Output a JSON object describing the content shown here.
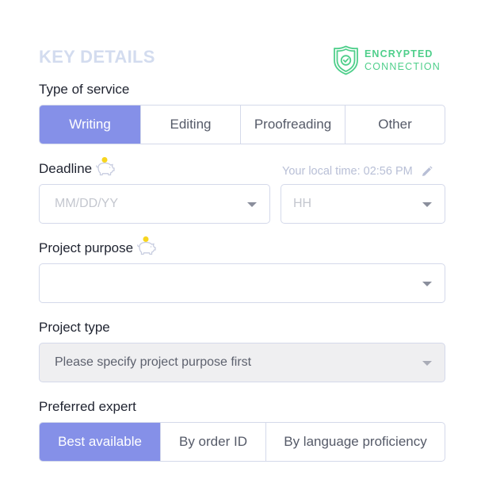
{
  "header": {
    "title": "KEY DETAILS",
    "secure_badge": {
      "icon": "shield-check-icon",
      "line1": "ENCRYPTED",
      "line2": "CONNECTION",
      "color": "#4fcf8b"
    }
  },
  "service": {
    "label": "Type of service",
    "options": [
      "Writing",
      "Editing",
      "Proofreading",
      "Other"
    ],
    "selected": "Writing"
  },
  "deadline": {
    "label": "Deadline",
    "icon": "piggy-bank-icon",
    "local_time_label": "Your local time: 02:56 PM",
    "edit_icon": "pencil-icon",
    "date_placeholder": "MM/DD/YY",
    "hour_placeholder": "HH"
  },
  "project_purpose": {
    "label": "Project purpose",
    "icon": "piggy-bank-icon",
    "value": ""
  },
  "project_type": {
    "label": "Project type",
    "placeholder": "Please specify project purpose first",
    "disabled": true
  },
  "preferred_expert": {
    "label": "Preferred expert",
    "options": [
      "Best available",
      "By order ID",
      "By language proficiency"
    ],
    "selected": "Best available"
  },
  "colors": {
    "accent": "#8590e8",
    "title": "#d3dcef",
    "border": "#d4d9ea",
    "secure_green": "#4fcf8b"
  }
}
